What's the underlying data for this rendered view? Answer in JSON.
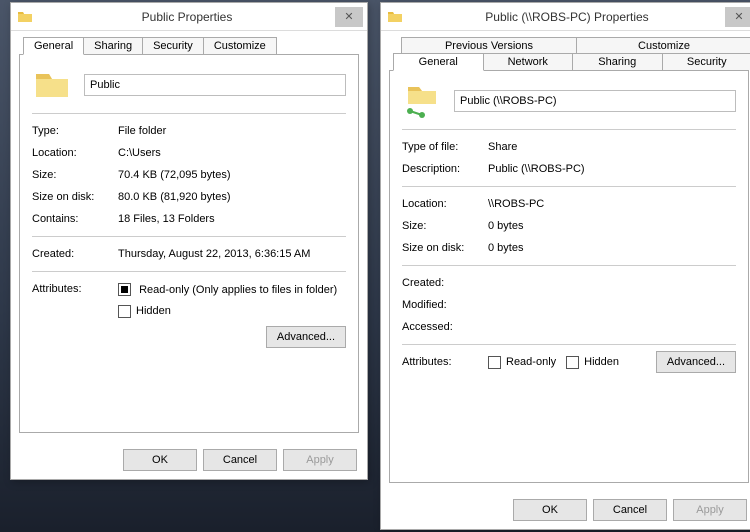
{
  "left": {
    "title": "Public Properties",
    "tabs": {
      "general": "General",
      "sharing": "Sharing",
      "security": "Security",
      "customize": "Customize"
    },
    "name_value": "Public",
    "fields": {
      "type_l": "Type:",
      "type_v": "File folder",
      "loc_l": "Location:",
      "loc_v": "C:\\Users",
      "size_l": "Size:",
      "size_v": "70.4 KB (72,095 bytes)",
      "sod_l": "Size on disk:",
      "sod_v": "80.0 KB (81,920 bytes)",
      "cont_l": "Contains:",
      "cont_v": "18 Files, 13 Folders",
      "created_l": "Created:",
      "created_v": "Thursday, August 22, 2013, 6:36:15 AM",
      "attr_l": "Attributes:",
      "ro_l": "Read-only (Only applies to files in folder)",
      "hid_l": "Hidden",
      "adv": "Advanced..."
    },
    "buttons": {
      "ok": "OK",
      "cancel": "Cancel",
      "apply": "Apply"
    }
  },
  "right": {
    "title": "Public (\\\\ROBS-PC) Properties",
    "tabs_top": {
      "prev": "Previous Versions",
      "cust": "Customize"
    },
    "tabs_bot": {
      "general": "General",
      "network": "Network",
      "sharing": "Sharing",
      "security": "Security"
    },
    "name_value": "Public (\\\\ROBS-PC)",
    "fields": {
      "typeof_l": "Type of file:",
      "typeof_v": "Share",
      "desc_l": "Description:",
      "desc_v": "Public (\\\\ROBS-PC)",
      "loc_l": "Location:",
      "loc_v": "\\\\ROBS-PC",
      "size_l": "Size:",
      "size_v": "0 bytes",
      "sod_l": "Size on disk:",
      "sod_v": "0 bytes",
      "created_l": "Created:",
      "mod_l": "Modified:",
      "acc_l": "Accessed:",
      "attr_l": "Attributes:",
      "ro_l": "Read-only",
      "hid_l": "Hidden",
      "adv": "Advanced..."
    },
    "buttons": {
      "ok": "OK",
      "cancel": "Cancel",
      "apply": "Apply"
    }
  }
}
